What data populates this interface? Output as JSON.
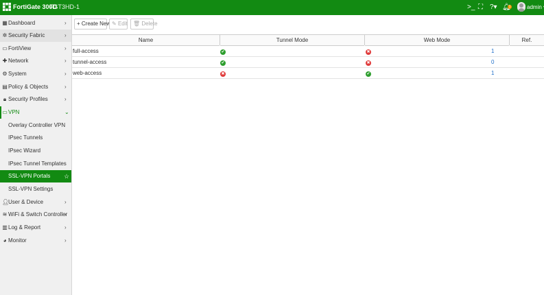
{
  "topbar": {
    "brand": "FortiGate 300D",
    "hostname": "FGT3HD-1",
    "notification_count": "1",
    "user": "admin"
  },
  "sidebar": {
    "items": [
      {
        "label": "Dashboard",
        "icon": "dashboard-icon"
      },
      {
        "label": "Security Fabric",
        "icon": "fabric-icon"
      },
      {
        "label": "FortiView",
        "icon": "fortiview-icon"
      },
      {
        "label": "Network",
        "icon": "network-icon"
      },
      {
        "label": "System",
        "icon": "gear-icon"
      },
      {
        "label": "Policy & Objects",
        "icon": "policy-icon"
      },
      {
        "label": "Security Profiles",
        "icon": "lock-icon"
      },
      {
        "label": "VPN",
        "icon": "monitor-icon"
      },
      {
        "label": "User & Device",
        "icon": "user-icon"
      },
      {
        "label": "WiFi & Switch Controller",
        "icon": "wifi-icon"
      },
      {
        "label": "Log & Report",
        "icon": "chart-icon"
      },
      {
        "label": "Monitor",
        "icon": "monitor-pie-icon"
      }
    ],
    "vpn_sub": [
      "Overlay Controller VPN",
      "IPsec Tunnels",
      "IPsec Wizard",
      "IPsec Tunnel Templates",
      "SSL-VPN Portals",
      "SSL-VPN Settings"
    ]
  },
  "toolbar": {
    "create_label": "Create New",
    "edit_label": "Edit",
    "delete_label": "Delete"
  },
  "table": {
    "columns": [
      "Name",
      "Tunnel Mode",
      "Web Mode",
      "Ref."
    ],
    "rows": [
      {
        "name": "full-access",
        "tunnel": true,
        "web": false,
        "ref": "1"
      },
      {
        "name": "tunnel-access",
        "tunnel": true,
        "web": false,
        "ref": "0"
      },
      {
        "name": "web-access",
        "tunnel": false,
        "web": true,
        "ref": "1"
      }
    ]
  },
  "colors": {
    "brand_green": "#128a12",
    "ok_green": "#2e9e2e",
    "error_red": "#e03b3b",
    "link_blue": "#1f6fc9"
  }
}
